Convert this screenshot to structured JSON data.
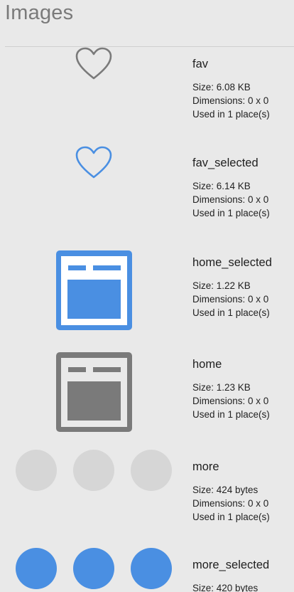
{
  "header": {
    "title": "Images"
  },
  "colors": {
    "accent": "#4a8fe2",
    "gray_icon": "#7a7a7a",
    "light_circle": "#d6d6d6",
    "background": "#e9e9e9"
  },
  "images": [
    {
      "name": "fav",
      "size": "Size: 6.08 KB",
      "dimensions": "Dimensions: 0 x 0",
      "used": "Used in 1 place(s)",
      "icon": "heart-outline-gray-icon"
    },
    {
      "name": "fav_selected",
      "size": "Size: 6.14 KB",
      "dimensions": "Dimensions: 0 x 0",
      "used": "Used in 1 place(s)",
      "icon": "heart-outline-blue-icon"
    },
    {
      "name": "home_selected",
      "size": "Size: 1.22 KB",
      "dimensions": "Dimensions: 0 x 0",
      "used": "Used in 1 place(s)",
      "icon": "home-window-blue-icon"
    },
    {
      "name": "home",
      "size": "Size: 1.23 KB",
      "dimensions": "Dimensions: 0 x 0",
      "used": "Used in 1 place(s)",
      "icon": "home-window-gray-icon"
    },
    {
      "name": "more",
      "size": "Size: 424 bytes",
      "dimensions": "Dimensions: 0 x 0",
      "used": "Used in 1 place(s)",
      "icon": "more-dots-gray-icon"
    },
    {
      "name": "more_selected",
      "size": "Size: 420 bytes",
      "dimensions": "",
      "used": "",
      "icon": "more-dots-blue-icon"
    }
  ]
}
